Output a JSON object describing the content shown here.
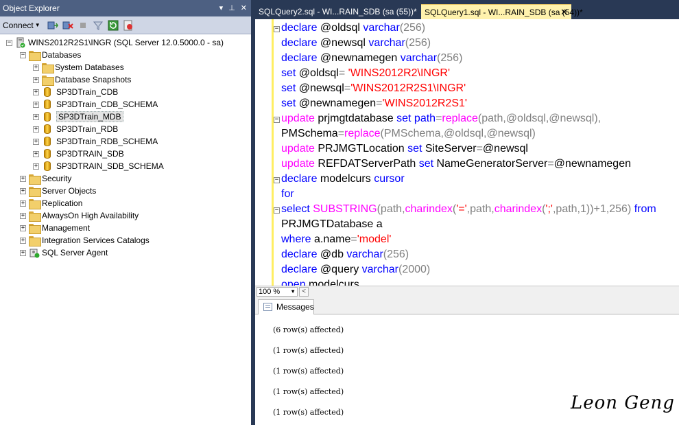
{
  "object_explorer": {
    "title": "Object Explorer",
    "pin_glyphs": "▾ ⊥ ✕",
    "toolbar": {
      "connect_label": "Connect"
    },
    "server": "WINS2012R2S1\\INGR (SQL Server 12.0.5000.0 - sa)",
    "databases_label": "Databases",
    "databases": [
      "System Databases",
      "Database Snapshots",
      "SP3DTrain_CDB",
      "SP3DTrain_CDB_SCHEMA",
      "SP3DTrain_MDB",
      "SP3DTrain_RDB",
      "SP3DTrain_RDB_SCHEMA",
      "SP3DTRAIN_SDB",
      "SP3DTRAIN_SDB_SCHEMA"
    ],
    "folders": [
      "Security",
      "Server Objects",
      "Replication",
      "AlwaysOn High Availability",
      "Management",
      "Integration Services Catalogs",
      "SQL Server Agent"
    ]
  },
  "tabs": {
    "inactive": "SQLQuery2.sql - WI...RAIN_SDB (sa (55))*",
    "active": "SQLQuery1.sql - WI...RAIN_SDB (sa (54))*",
    "close_glyph": "✕"
  },
  "code": {
    "l1a": "declare",
    "l1b": " @oldsql ",
    "l1c": "varchar",
    "l1d": "(256)",
    "l2a": "declare",
    "l2b": " @newsql ",
    "l2c": "varchar",
    "l2d": "(256)",
    "l3a": "declare",
    "l3b": " @newnamegen ",
    "l3c": "varchar",
    "l3d": "(256)",
    "l4a": "set",
    "l4b": " @oldsql",
    "l4c": "= ",
    "l4d": "'WINS2012R2\\INGR'",
    "l5a": "set",
    "l5b": " @newsql",
    "l5c": "=",
    "l5d": "'WINS2012R2S1\\INGR'",
    "l6a": "set",
    "l6b": " @newnamegen",
    "l6c": "=",
    "l6d": "'WINS2012R2S1'",
    "l7a": "update",
    "l7b": " prjmgtdatabase ",
    "l7c": "set",
    "l7d": " path",
    "l7e": "=",
    "l7f": "replace",
    "l7g": "(path,@oldsql,@newsql),",
    "l8a": "PMSchema",
    "l8b": "=",
    "l8c": "replace",
    "l8d": "(PMSchema,@oldsql,@newsql)",
    "l9a": "update",
    "l9b": " PRJMGTLocation ",
    "l9c": "set",
    "l9d": " SiteServer",
    "l9e": "=",
    "l9f": "@newsql",
    "l10a": "update",
    "l10b": " REFDATServerPath ",
    "l10c": "set",
    "l10d": " NameGeneratorServer",
    "l10e": "=",
    "l10f": "@newnamegen",
    "l11a": "declare",
    "l11b": " modelcurs ",
    "l11c": "cursor",
    "l12a": "for",
    "l13a": "select",
    "l13b": " SUBSTRING",
    "l13c": "(path,",
    "l13d": "charindex",
    "l13e": "(",
    "l13f": "'='",
    "l13g": ",path,",
    "l13h": "charindex",
    "l13i": "(",
    "l13j": "';'",
    "l13k": ",path,1))+1,256) ",
    "l13l": "from",
    "l14a": "PRJMGTDatabase a",
    "l15a": "where",
    "l15b": " a.name",
    "l15c": "=",
    "l15d": "'model'",
    "l16a": "declare",
    "l16b": " @db ",
    "l16c": "varchar",
    "l16d": "(256)",
    "l17a": "declare",
    "l17b": " @query ",
    "l17c": "varchar",
    "l17d": "(2000)",
    "l18a": "open",
    "l18b": " modelcurs"
  },
  "zoom": {
    "value": "100 %"
  },
  "results": {
    "tab_label": "Messages",
    "messages": [
      "(6 row(s) affected)",
      "(1 row(s) affected)",
      "(1 row(s) affected)",
      "(1 row(s) affected)",
      "(1 row(s) affected)"
    ]
  },
  "signature": "Leon Geng",
  "colors": {
    "titlebar": "#4d6082",
    "background": "#293955",
    "active_tab": "#fff2ad",
    "keyword": "#0000ff",
    "function": "#ff00ff",
    "string": "#ff0000"
  }
}
